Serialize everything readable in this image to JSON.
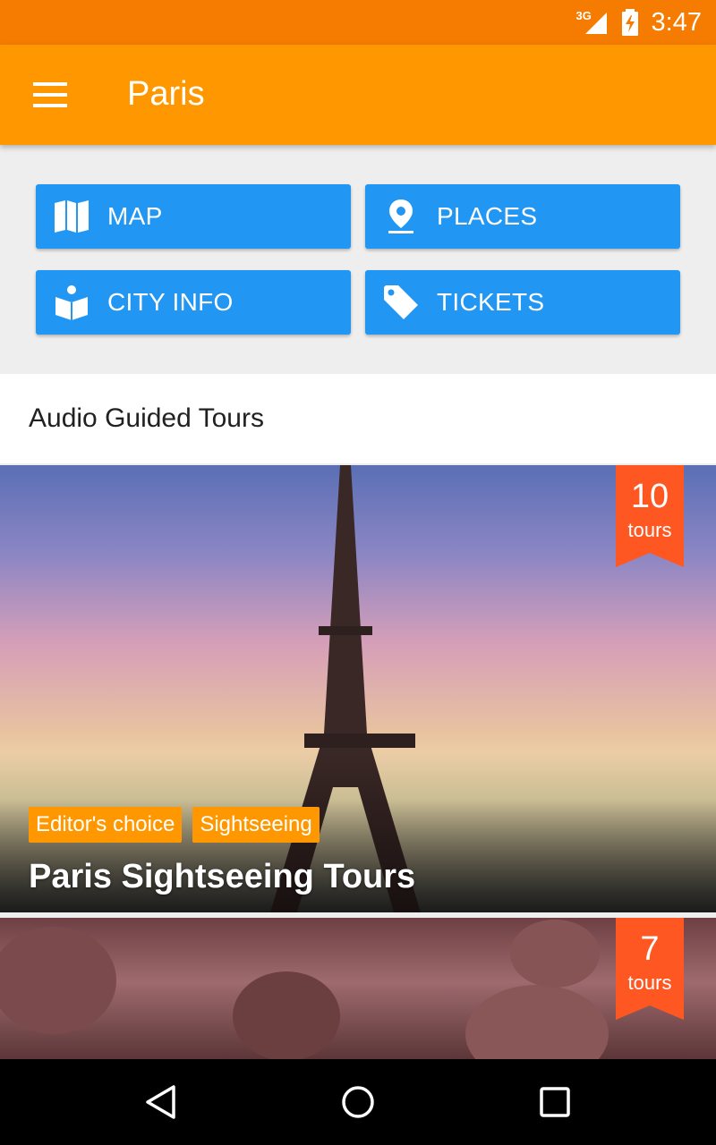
{
  "status_bar": {
    "network": "3G",
    "time": "3:47",
    "signal_icon": "signal-icon",
    "battery_icon": "battery-charging-icon"
  },
  "app_bar": {
    "menu_icon": "hamburger-menu-icon",
    "title": "Paris"
  },
  "buttons": [
    {
      "label": "MAP",
      "icon": "map-icon"
    },
    {
      "label": "PLACES",
      "icon": "place-pin-icon"
    },
    {
      "label": "CITY INFO",
      "icon": "book-info-icon"
    },
    {
      "label": "TICKETS",
      "icon": "tag-icon"
    }
  ],
  "section": {
    "title": "Audio Guided Tours"
  },
  "tours": [
    {
      "count": "10",
      "count_unit": "tours",
      "tags": [
        "Editor's choice",
        "Sightseeing"
      ],
      "title": "Paris Sightseeing Tours"
    },
    {
      "count": "7",
      "count_unit": "tours"
    }
  ],
  "nav": {
    "back_icon": "back-icon",
    "home_icon": "home-icon",
    "recents_icon": "recents-icon"
  },
  "colors": {
    "status_bar": "#f57c00",
    "app_bar": "#ff9800",
    "button": "#2196f3",
    "ribbon": "#ff5722",
    "tag": "#ff9800"
  }
}
